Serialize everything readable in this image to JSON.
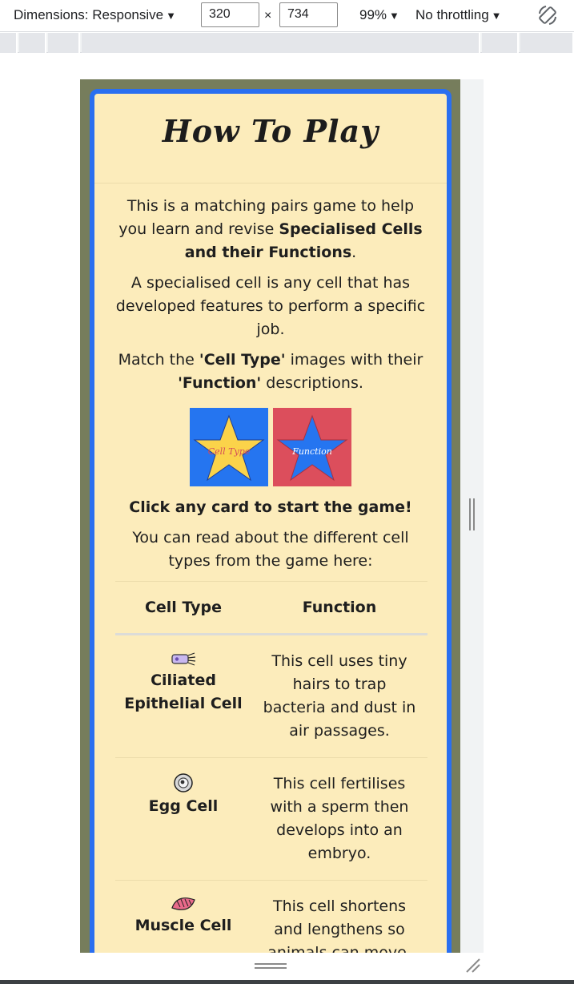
{
  "devtools": {
    "dimensions_label": "Dimensions: Responsive",
    "width_value": "320",
    "times_sign": "×",
    "height_value": "734",
    "zoom_label": "99%",
    "throttle_label": "No throttling",
    "caret": "▼"
  },
  "modal": {
    "title": "How To Play",
    "intro_pre": "This is a matching pairs game to help you learn and revise ",
    "intro_bold": "Specialised Cells and their Functions",
    "intro_post": ".",
    "definition": "A specialised cell is any cell that has developed features to perform a specific job.",
    "match_pre": "Match the ",
    "match_bold1": "'Cell Type'",
    "match_mid": " images with their ",
    "match_bold2": "'Function'",
    "match_post": " descriptions.",
    "star_cell_label": "Cell Type",
    "star_function_label": "Function",
    "cta": "Click any card to start the game!",
    "read_more": "You can read about the different cell types from the game here:",
    "table": {
      "headers": [
        "Cell Type",
        "Function"
      ],
      "rows": [
        {
          "icon": "ciliated-cell-icon",
          "type": "Ciliated Epithelial Cell",
          "function": "This cell uses tiny hairs to trap bacteria and dust in air passages."
        },
        {
          "icon": "egg-cell-icon",
          "type": "Egg Cell",
          "function": "This cell fertilises with a sperm then develops into an embryo."
        },
        {
          "icon": "muscle-cell-icon",
          "type": "Muscle Cell",
          "function": "This cell shortens and lengthens so animals can move."
        }
      ]
    }
  },
  "colors": {
    "modal_border": "#2a6ff0",
    "modal_bg": "#fcecbb",
    "backdrop": "#767d5c",
    "star_card_blue": "#2575f0",
    "star_card_red": "#dc4e5c",
    "star_yellow": "#fbd34a"
  }
}
